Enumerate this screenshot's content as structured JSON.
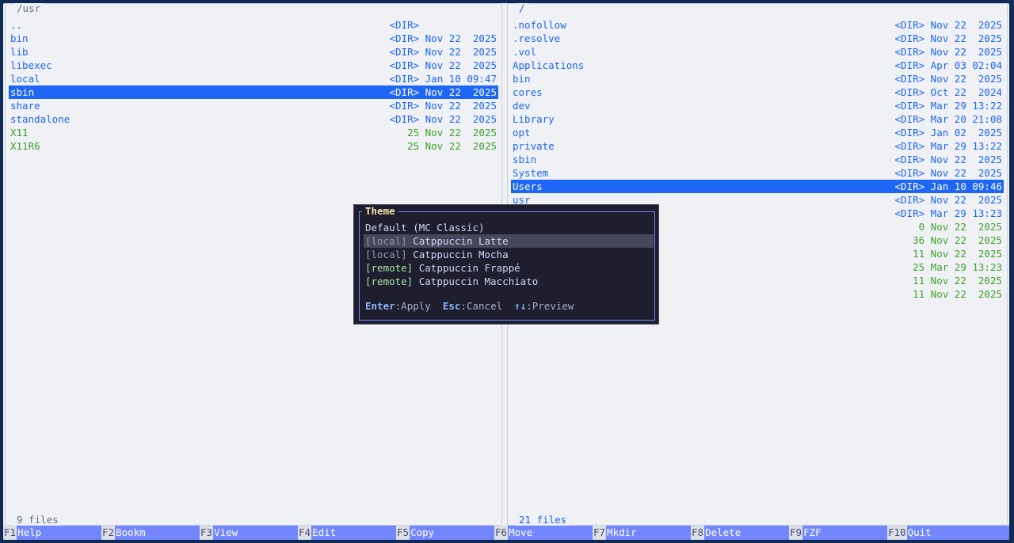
{
  "left_panel": {
    "path": "/usr",
    "rows": [
      {
        "name": "..",
        "meta": "<DIR>             ",
        "kind": "dir"
      },
      {
        "name": "bin",
        "meta": "<DIR> Nov 22  2025",
        "kind": "dir"
      },
      {
        "name": "lib",
        "meta": "<DIR> Nov 22  2025",
        "kind": "dir"
      },
      {
        "name": "libexec",
        "meta": "<DIR> Nov 22  2025",
        "kind": "dir"
      },
      {
        "name": "local",
        "meta": "<DIR> Jan 10 09:47",
        "kind": "dir"
      },
      {
        "name": "sbin",
        "meta": "<DIR> Nov 22  2025",
        "kind": "dir",
        "selected": true
      },
      {
        "name": "share",
        "meta": "<DIR> Nov 22  2025",
        "kind": "dir"
      },
      {
        "name": "standalone",
        "meta": "<DIR> Nov 22  2025",
        "kind": "dir"
      },
      {
        "name": "X11",
        "meta": "25 Nov 22  2025",
        "kind": "link"
      },
      {
        "name": "X11R6",
        "meta": "25 Nov 22  2025",
        "kind": "link"
      }
    ],
    "count": "9 files"
  },
  "right_panel": {
    "path": "/",
    "rows": [
      {
        "name": ".nofollow",
        "meta": "<DIR> Nov 22  2025",
        "kind": "dir"
      },
      {
        "name": ".resolve",
        "meta": "<DIR> Nov 22  2025",
        "kind": "dir"
      },
      {
        "name": ".vol",
        "meta": "<DIR> Nov 22  2025",
        "kind": "dir"
      },
      {
        "name": "Applications",
        "meta": "<DIR> Apr 03 02:04",
        "kind": "dir"
      },
      {
        "name": "bin",
        "meta": "<DIR> Nov 22  2025",
        "kind": "dir"
      },
      {
        "name": "cores",
        "meta": "<DIR> Oct 22  2024",
        "kind": "dir"
      },
      {
        "name": "dev",
        "meta": "<DIR> Mar 29 13:22",
        "kind": "dir"
      },
      {
        "name": "Library",
        "meta": "<DIR> Mar 20 21:08",
        "kind": "dir"
      },
      {
        "name": "opt",
        "meta": "<DIR> Jan 02  2025",
        "kind": "dir"
      },
      {
        "name": "private",
        "meta": "<DIR> Mar 29 13:22",
        "kind": "dir"
      },
      {
        "name": "sbin",
        "meta": "<DIR> Nov 22  2025",
        "kind": "dir"
      },
      {
        "name": "System",
        "meta": "<DIR> Nov 22  2025",
        "kind": "dir"
      },
      {
        "name": "Users",
        "meta": "<DIR> Jan 10 09:46",
        "kind": "dir",
        "selected": true
      },
      {
        "name": "usr",
        "meta": "<DIR> Nov 22  2025",
        "kind": "dir"
      },
      {
        "name": "",
        "meta": "<DIR> Mar 29 13:23",
        "kind": "dir"
      },
      {
        "name": "",
        "meta": "0 Nov 22  2025",
        "kind": "link"
      },
      {
        "name": "",
        "meta": "36 Nov 22  2025",
        "kind": "link"
      },
      {
        "name": "",
        "meta": "11 Nov 22  2025",
        "kind": "link"
      },
      {
        "name": "",
        "meta": "25 Mar 29 13:23",
        "kind": "link"
      },
      {
        "name": "",
        "meta": "11 Nov 22  2025",
        "kind": "link"
      },
      {
        "name": "",
        "meta": "11 Nov 22  2025",
        "kind": "link"
      }
    ],
    "count": "21 files"
  },
  "theme_dialog": {
    "title": "Theme",
    "options": [
      {
        "tag": "",
        "tag_kind": "",
        "name": "Default (MC Classic)"
      },
      {
        "tag": "[local]",
        "tag_kind": "local",
        "name": " Catppuccin Latte",
        "highlighted": true
      },
      {
        "tag": "[local]",
        "tag_kind": "local",
        "name": " Catppuccin Mocha"
      },
      {
        "tag": "[remote]",
        "tag_kind": "remote",
        "name": " Catppuccin Frappé"
      },
      {
        "tag": "[remote]",
        "tag_kind": "remote",
        "name": " Catppuccin Macchiato"
      }
    ],
    "hints": [
      {
        "key": "Enter",
        "text": ":Apply  "
      },
      {
        "key": "Esc",
        "text": ":Cancel  "
      },
      {
        "key": "↑↓",
        "text": ":Preview"
      }
    ]
  },
  "function_keys": [
    {
      "num": "F1",
      "label": "Help"
    },
    {
      "num": "F2",
      "label": "Bookm"
    },
    {
      "num": "F3",
      "label": "View"
    },
    {
      "num": "F4",
      "label": "Edit"
    },
    {
      "num": "F5",
      "label": "Copy"
    },
    {
      "num": "F6",
      "label": "Move"
    },
    {
      "num": "F7",
      "label": "Mkdir"
    },
    {
      "num": "F8",
      "label": "Delete"
    },
    {
      "num": "F9",
      "label": "FZF"
    },
    {
      "num": "F10",
      "label": "Quit"
    }
  ],
  "colors": {
    "dir": "#1e66f5",
    "link": "#40a02b",
    "selected_bg": "#1e66f5",
    "dialog_bg": "#1e1e2e",
    "fkey_bg": "#7287fd"
  }
}
